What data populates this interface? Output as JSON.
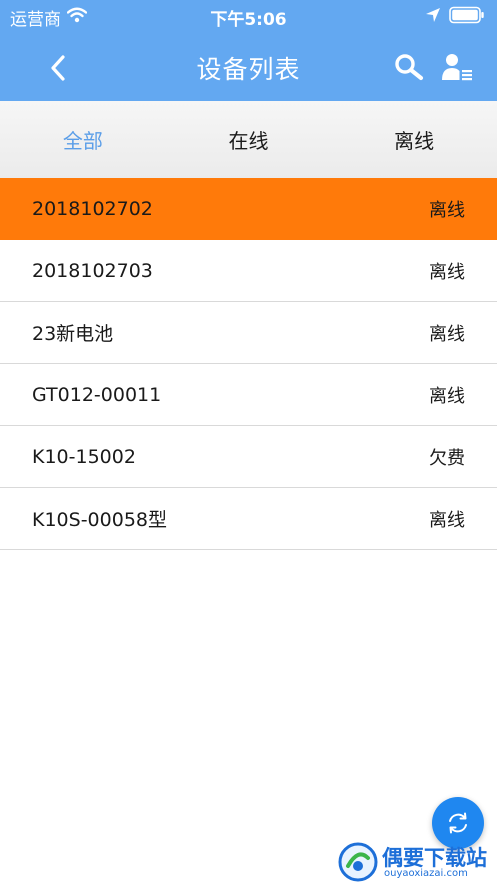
{
  "status_bar": {
    "carrier": "运营商",
    "time": "下午5:06"
  },
  "nav": {
    "title": "设备列表"
  },
  "tabs": [
    {
      "label": "全部",
      "active": true
    },
    {
      "label": "在线",
      "active": false
    },
    {
      "label": "离线",
      "active": false
    }
  ],
  "devices": [
    {
      "name": "2018102702",
      "status": "离线"
    },
    {
      "name": "2018102703",
      "status": "离线"
    },
    {
      "name": "23新电池",
      "status": "离线"
    },
    {
      "name": "GT012-00011",
      "status": "离线"
    },
    {
      "name": "K10-15002",
      "status": "欠费"
    },
    {
      "name": "K10S-00058型",
      "status": "离线"
    }
  ],
  "watermark": {
    "title": "偶要下载站",
    "subtitle": "ouyaoxiazai.com"
  },
  "colors": {
    "header": "#63a8f1",
    "active_tab": "#5b9ee8",
    "highlight_row": "#ff7a0a",
    "fab": "#1f87f0"
  },
  "icons": {
    "back": "chevron-left-icon",
    "search": "search-icon",
    "user_list": "user-list-icon",
    "refresh": "refresh-icon",
    "wifi": "wifi-icon",
    "location": "location-arrow-icon",
    "battery": "battery-icon"
  }
}
